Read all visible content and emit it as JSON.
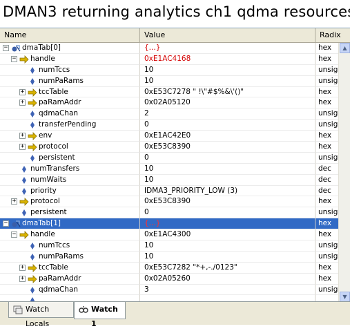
{
  "caption": "DMAN3 returning analytics ch1 qdma resources",
  "columns": {
    "name": "Name",
    "value": "Value",
    "radix": "Radix"
  },
  "rows": [
    {
      "level": 0,
      "expand": "-",
      "icon": "struct",
      "name": "dmaTab[0]",
      "value": "{...}",
      "radix": "hex",
      "value_red": true
    },
    {
      "level": 1,
      "expand": "-",
      "icon": "pointer",
      "name": "handle",
      "value": "0xE1AC4168",
      "radix": "hex",
      "value_red": true
    },
    {
      "level": 2,
      "expand": "",
      "icon": "field",
      "name": "numTccs",
      "value": "10",
      "radix": "unsign"
    },
    {
      "level": 2,
      "expand": "",
      "icon": "field",
      "name": "numPaRams",
      "value": "10",
      "radix": "unsign"
    },
    {
      "level": 2,
      "expand": "+",
      "icon": "pointer",
      "name": "tccTable",
      "value": "0xE53C7278 \" !\\\"#$%&\\'()\"",
      "radix": "hex"
    },
    {
      "level": 2,
      "expand": "+",
      "icon": "pointer",
      "name": "paRamAddr",
      "value": "0x02A05120",
      "radix": "hex"
    },
    {
      "level": 2,
      "expand": "",
      "icon": "field",
      "name": "qdmaChan",
      "value": "2",
      "radix": "unsign"
    },
    {
      "level": 2,
      "expand": "",
      "icon": "field",
      "name": "transferPending",
      "value": "0",
      "radix": "unsign"
    },
    {
      "level": 2,
      "expand": "+",
      "icon": "pointer",
      "name": "env",
      "value": "0xE1AC42E0",
      "radix": "hex"
    },
    {
      "level": 2,
      "expand": "+",
      "icon": "pointer",
      "name": "protocol",
      "value": "0xE53C8390",
      "radix": "hex"
    },
    {
      "level": 2,
      "expand": "",
      "icon": "field",
      "name": "persistent",
      "value": "0",
      "radix": "unsign"
    },
    {
      "level": 1,
      "expand": "",
      "icon": "field",
      "name": "numTransfers",
      "value": "10",
      "radix": "dec"
    },
    {
      "level": 1,
      "expand": "",
      "icon": "field",
      "name": "numWaits",
      "value": "10",
      "radix": "dec"
    },
    {
      "level": 1,
      "expand": "",
      "icon": "field",
      "name": "priority",
      "value": "IDMA3_PRIORITY_LOW (3)",
      "radix": "dec"
    },
    {
      "level": 1,
      "expand": "+",
      "icon": "pointer",
      "name": "protocol",
      "value": "0xE53C8390",
      "radix": "hex"
    },
    {
      "level": 1,
      "expand": "",
      "icon": "field",
      "name": "persistent",
      "value": "0",
      "radix": "unsign"
    },
    {
      "level": 0,
      "expand": "-",
      "icon": "struct",
      "name": "dmaTab[1]",
      "value": "{...}",
      "radix": "hex",
      "selected": true
    },
    {
      "level": 1,
      "expand": "-",
      "icon": "pointer",
      "name": "handle",
      "value": "0xE1AC4300",
      "radix": "hex"
    },
    {
      "level": 2,
      "expand": "",
      "icon": "field",
      "name": "numTccs",
      "value": "10",
      "radix": "unsign"
    },
    {
      "level": 2,
      "expand": "",
      "icon": "field",
      "name": "numPaRams",
      "value": "10",
      "radix": "unsign"
    },
    {
      "level": 2,
      "expand": "+",
      "icon": "pointer",
      "name": "tccTable",
      "value": "0xE53C7282 \"*+,-./0123\"",
      "radix": "hex"
    },
    {
      "level": 2,
      "expand": "+",
      "icon": "pointer",
      "name": "paRamAddr",
      "value": "0x02A05260",
      "radix": "hex"
    },
    {
      "level": 2,
      "expand": "",
      "icon": "field",
      "name": "qdmaChan",
      "value": "3",
      "radix": "unsign"
    },
    {
      "level": 2,
      "expand": "",
      "icon": "field",
      "name": "",
      "value": "",
      "radix": ""
    }
  ],
  "tabs": [
    {
      "label": "Watch Locals",
      "icon": "watch-locals-icon",
      "active": false
    },
    {
      "label": "Watch 1",
      "icon": "watch-icon",
      "active": true
    }
  ],
  "colors": {
    "selection": "#316ac5",
    "changed_value": "#d40000",
    "pointer_icon": "#d9b300",
    "struct_icon": "#3a5ea8",
    "field_icon": "#3f63b5"
  }
}
